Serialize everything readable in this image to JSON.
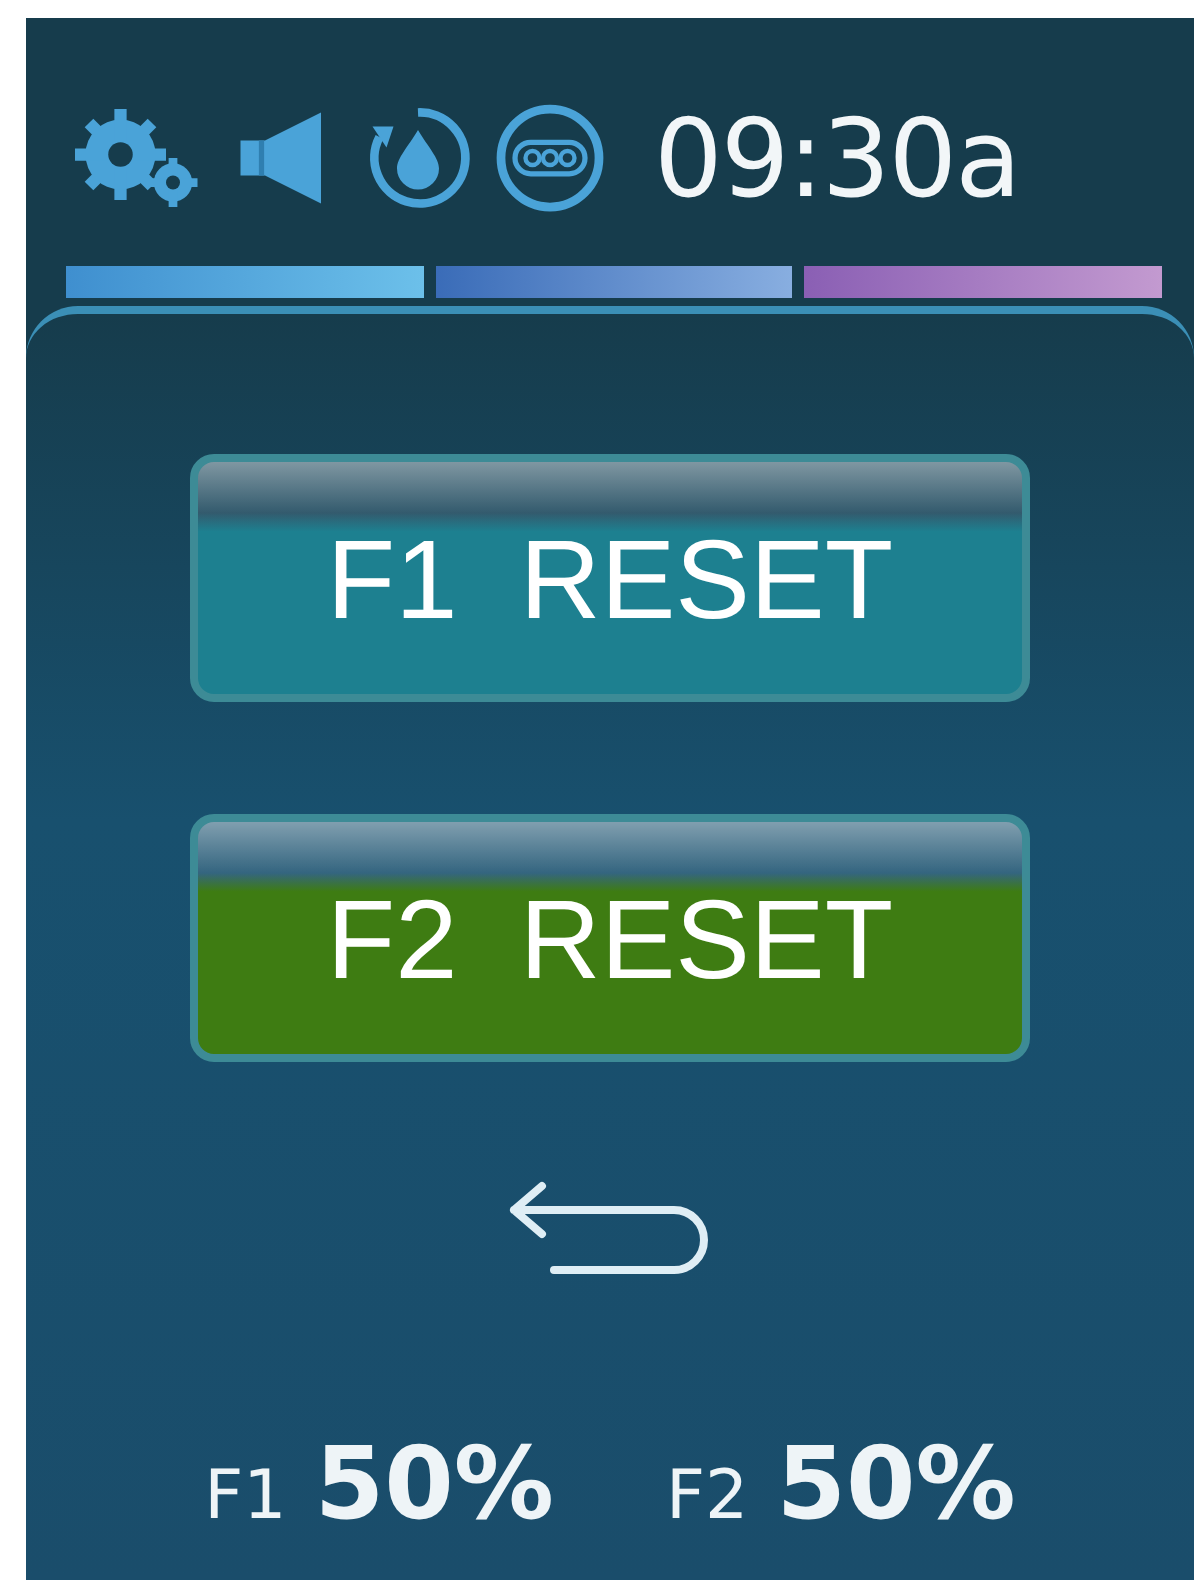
{
  "status_bar": {
    "time": "09:30a"
  },
  "buttons": [
    {
      "label": "F1  RESET",
      "color": "#1d8090"
    },
    {
      "label": "F2  RESET",
      "color": "#3e7c12"
    }
  ],
  "readings": [
    {
      "label": "F1",
      "value": "50%"
    },
    {
      "label": "F2",
      "value": "50%"
    }
  ]
}
